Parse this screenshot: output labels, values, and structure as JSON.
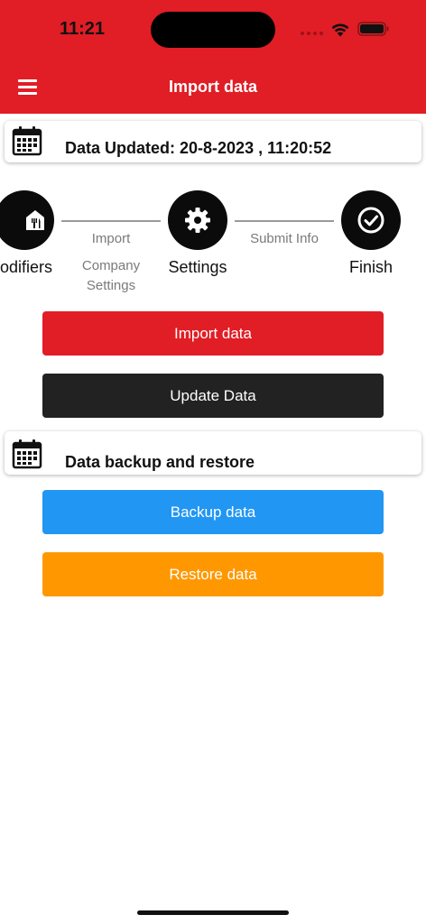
{
  "status_bar": {
    "time": "11:21"
  },
  "header": {
    "title": "Import data",
    "menu_icon": "hamburger-menu-icon"
  },
  "updated_card": {
    "icon": "calendar-icon",
    "text": "Data Updated: 20-8-2023 , 11:20:52"
  },
  "stepper": {
    "steps": [
      {
        "label": "odifiers",
        "icon": "restaurant-menu-icon"
      },
      {
        "label": "Settings",
        "icon": "gear-icon"
      },
      {
        "label": "Finish",
        "icon": "check-circle-icon"
      }
    ],
    "connectors": [
      {
        "line1": "Import",
        "line2": "Company",
        "line3": "Settings"
      },
      {
        "line1": "Submit Info"
      }
    ]
  },
  "buttons": {
    "import": "Import data",
    "update": "Update Data",
    "backup": "Backup data",
    "restore": "Restore data"
  },
  "backup_card": {
    "icon": "calendar-icon",
    "text": "Data backup and restore"
  },
  "colors": {
    "header": "#e11d25",
    "import": "#e11d25",
    "update": "#222222",
    "backup": "#2196f3",
    "restore": "#ff9800"
  }
}
